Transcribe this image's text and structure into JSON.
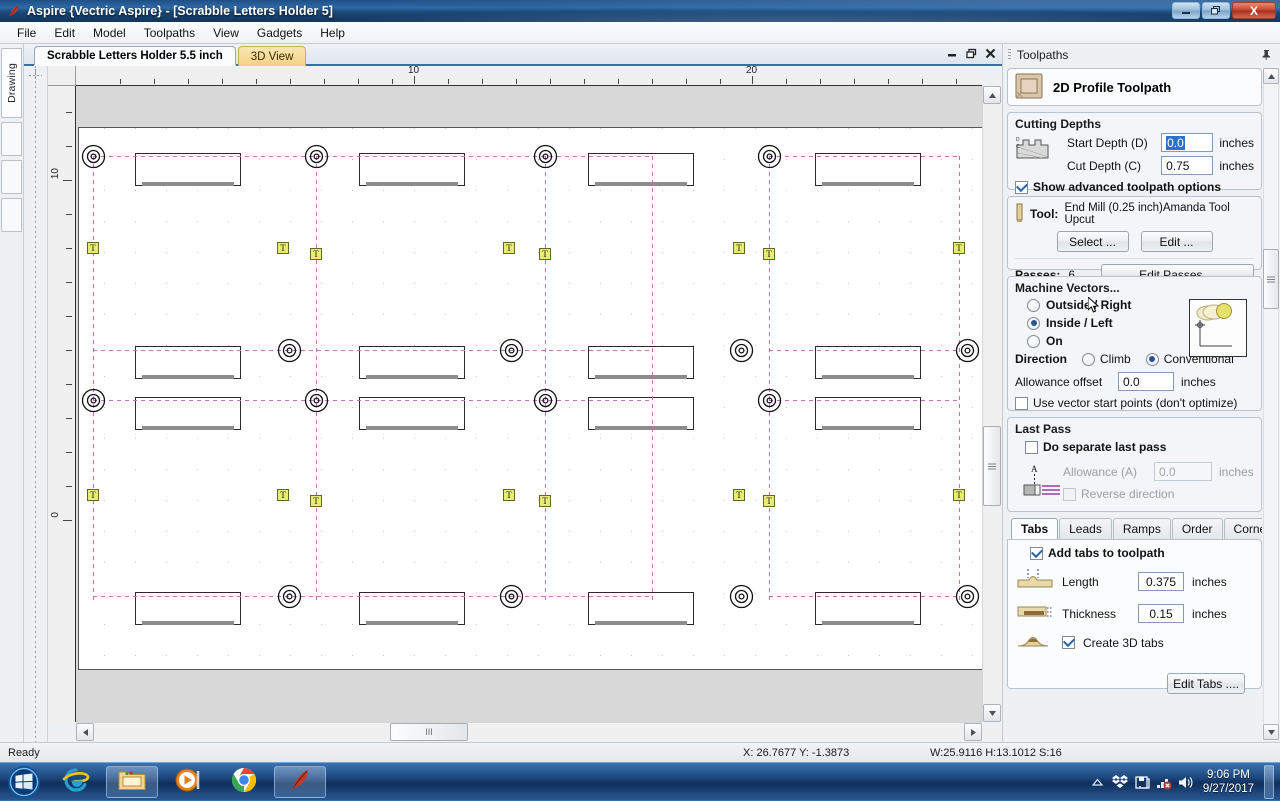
{
  "window": {
    "title": "Aspire {Vectric Aspire} - [Scrabble Letters Holder 5]",
    "icon": "aspire-feather-icon",
    "minimize_label": "Minimize",
    "restore_label": "Restore",
    "close_label": "X"
  },
  "menu": {
    "items": [
      {
        "label": "File"
      },
      {
        "label": "Edit"
      },
      {
        "label": "Model"
      },
      {
        "label": "Toolpaths"
      },
      {
        "label": "View"
      },
      {
        "label": "Gadgets"
      },
      {
        "label": "Help"
      }
    ]
  },
  "left_dock": {
    "tabs": [
      {
        "label": "Drawing"
      },
      {
        "label": ""
      },
      {
        "label": ""
      },
      {
        "label": ""
      }
    ]
  },
  "doc_tabs": {
    "tabs": [
      {
        "label": "Scrabble Letters Holder 5.5 inch",
        "active": true
      },
      {
        "label": "3D View",
        "active": false
      }
    ]
  },
  "canvas": {
    "h_ruler_labels": [
      "10",
      "20"
    ],
    "v_ruler_labels": [
      "10",
      "0"
    ],
    "scroll_thumb_glyph": "III"
  },
  "toolpaths_panel": {
    "header": "Toolpaths",
    "pin_icon": "pin-icon",
    "operation": {
      "title": "2D Profile Toolpath",
      "icon": "profile-toolpath-icon"
    },
    "cutting_depths": {
      "title": "Cutting Depths",
      "icon": "cut-depth-diagram-icon",
      "start_depth_label": "Start Depth (D)",
      "start_depth_value": "0.0",
      "start_depth_units": "inches",
      "cut_depth_label": "Cut Depth (C)",
      "cut_depth_value": "0.75",
      "cut_depth_units": "inches",
      "advanced_label": "Show advanced toolpath options",
      "advanced_checked": true
    },
    "tool": {
      "icon": "end-mill-icon",
      "label": "Tool:",
      "name": "End Mill (0.25 inch)Amanda Tool Upcut",
      "select_label": "Select ...",
      "edit_label": "Edit ...",
      "passes_label": "Passes:",
      "passes_value": "6",
      "edit_passes_label": "Edit Passes ..."
    },
    "machine_vectors": {
      "title": "Machine Vectors...",
      "preview_icon": "vector-offset-preview-icon",
      "options": [
        {
          "label": "Outside / Right",
          "selected": false
        },
        {
          "label": "Inside / Left",
          "selected": true
        },
        {
          "label": "On",
          "selected": false
        }
      ],
      "direction_label": "Direction",
      "direction_options": [
        {
          "label": "Climb",
          "selected": false
        },
        {
          "label": "Conventional",
          "selected": true
        }
      ],
      "allowance_label": "Allowance offset",
      "allowance_value": "0.0",
      "allowance_units": "inches",
      "start_points_label": "Use vector start points (don't optimize)",
      "start_points_checked": false
    },
    "last_pass": {
      "title": "Last Pass",
      "icon": "last-pass-diagram-icon",
      "separate_label": "Do separate last pass",
      "separate_checked": false,
      "allowance_label": "Allowance (A)",
      "allowance_value": "0.0",
      "allowance_units": "inches",
      "reverse_label": "Reverse direction",
      "reverse_checked": false,
      "diagram_letter": "A"
    },
    "bottom_tabs": {
      "tabs": [
        {
          "label": "Tabs",
          "active": true
        },
        {
          "label": "Leads",
          "active": false
        },
        {
          "label": "Ramps",
          "active": false
        },
        {
          "label": "Order",
          "active": false
        },
        {
          "label": "Corners",
          "active": false
        }
      ],
      "add_tabs_label": "Add tabs to toolpath",
      "add_tabs_checked": true,
      "length_label": "Length",
      "length_value": "0.375",
      "length_units": "inches",
      "length_icon": "tab-length-icon",
      "thickness_label": "Thickness",
      "thickness_value": "0.15",
      "thickness_units": "inches",
      "thickness_icon": "tab-thickness-icon",
      "create_3d_label": "Create 3D tabs",
      "create_3d_checked": true,
      "create_3d_icon": "tab-3d-icon",
      "edit_tabs_label": "Edit Tabs ...."
    }
  },
  "statusbar": {
    "ready": "Ready",
    "coords": "X: 26.7677 Y: -1.3873",
    "dimensions": "W:25.9116  H:13.1012  S:16"
  },
  "taskbar": {
    "start_icon": "windows-start-orb-icon",
    "items": [
      {
        "icon": "internet-explorer-icon",
        "running": false
      },
      {
        "icon": "windows-explorer-icon",
        "running": true
      },
      {
        "icon": "windows-media-player-icon",
        "running": false
      },
      {
        "icon": "google-chrome-icon",
        "running": false
      },
      {
        "icon": "aspire-feather-icon",
        "running": true
      }
    ],
    "tray": [
      {
        "icon": "show-hidden-icons-icon"
      },
      {
        "icon": "dropbox-icon"
      },
      {
        "icon": "removable-media-icon"
      },
      {
        "icon": "network-error-icon"
      },
      {
        "icon": "volume-icon"
      }
    ],
    "time": "9:06 PM",
    "date": "9/27/2017"
  }
}
